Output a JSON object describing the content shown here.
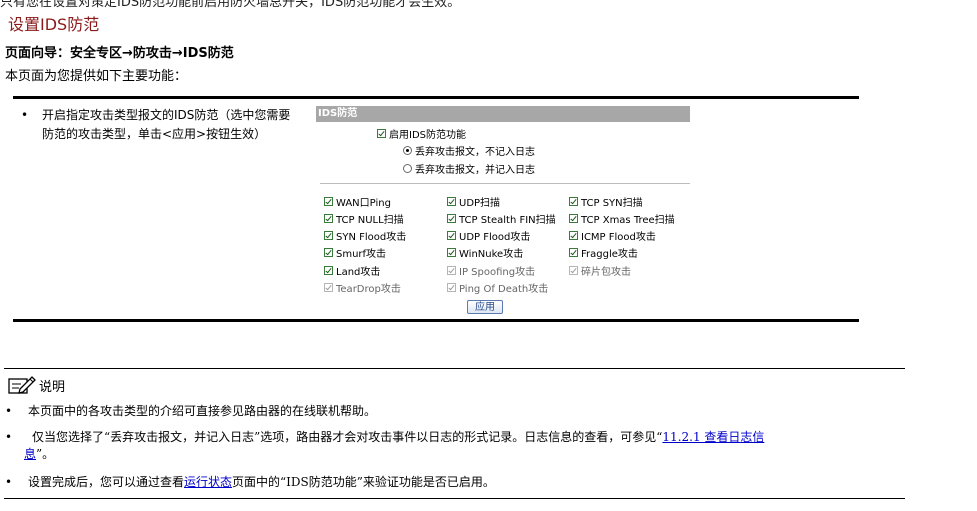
{
  "top_cut_text": "只有您在设置对策定IDS防范功能前启用防火墙总开关，IDS防范功能才会生效。",
  "section_title": "设置IDS防范",
  "nav_path": "页面向导：安全专区→防攻击→IDS防范",
  "intro": "本页面为您提供如下主要功能：",
  "feature_line1": "开启指定攻击类型报文的IDS防范（选中您需要",
  "feature_line2": "防范的攻击类型，单击<应用>按钮生效）",
  "panel": {
    "header": "IDS防范",
    "enable_label": "启用IDS防范功能",
    "radio1_label": "丢弃攻击报文，不记入日志",
    "radio2_label": "丢弃攻击报文，并记入日志",
    "apply_label": "应用",
    "attacks": [
      {
        "label": "WAN口Ping",
        "checked": true,
        "disabled": false
      },
      {
        "label": "UDP扫描",
        "checked": true,
        "disabled": false
      },
      {
        "label": "TCP SYN扫描",
        "checked": true,
        "disabled": false
      },
      {
        "label": "TCP NULL扫描",
        "checked": true,
        "disabled": false
      },
      {
        "label": "TCP Stealth FIN扫描",
        "checked": true,
        "disabled": false
      },
      {
        "label": "TCP Xmas Tree扫描",
        "checked": true,
        "disabled": false
      },
      {
        "label": "SYN Flood攻击",
        "checked": true,
        "disabled": false
      },
      {
        "label": "UDP Flood攻击",
        "checked": true,
        "disabled": false
      },
      {
        "label": "ICMP Flood攻击",
        "checked": true,
        "disabled": false
      },
      {
        "label": "Smurf攻击",
        "checked": true,
        "disabled": false
      },
      {
        "label": "WinNuke攻击",
        "checked": true,
        "disabled": false
      },
      {
        "label": "Fraggle攻击",
        "checked": true,
        "disabled": false
      },
      {
        "label": "Land攻击",
        "checked": true,
        "disabled": false
      },
      {
        "label": "IP Spoofing攻击",
        "checked": true,
        "disabled": true
      },
      {
        "label": "碎片包攻击",
        "checked": true,
        "disabled": true
      },
      {
        "label": "TearDrop攻击",
        "checked": true,
        "disabled": true
      },
      {
        "label": "Ping Of Death攻击",
        "checked": true,
        "disabled": true
      }
    ]
  },
  "note": {
    "title": "说明",
    "icon": "note-pencil-icon",
    "item1": "本页面中的各攻击类型的介绍可直接参见路由器的在线联机帮助。",
    "item2_pre": "仅当您选择了“丢弃攻击报文，并记入日志”选项，路由器才会对攻击事件以日志的形式记录。日志信息的查看，可参见“",
    "item2_link_a": "11.2.1  查看日志信",
    "item2_link_b": "息",
    "item2_post": "”。",
    "item3_pre": "设置完成后，您可以通过查看",
    "item3_link": "运行状态",
    "item3_post": "页面中的“IDS防范功能”来验证功能是否已启用。"
  }
}
